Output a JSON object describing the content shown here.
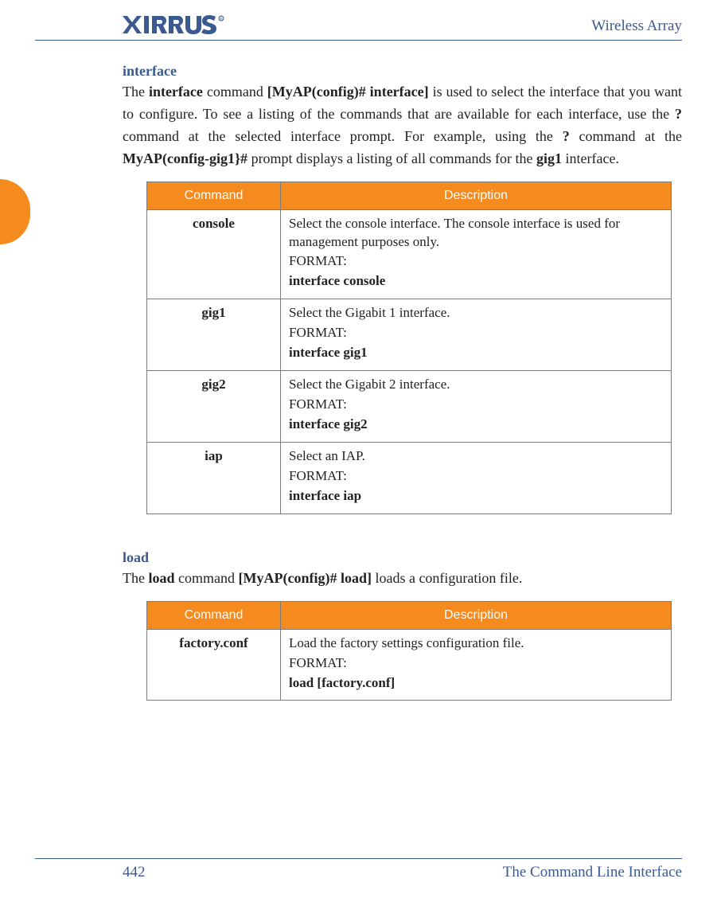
{
  "header": {
    "logo_text": "XIRRUS",
    "doc_title": "Wireless Array"
  },
  "sections": [
    {
      "title": "interface",
      "intro_html": "The <b>interface</b> command <b>[MyAP(config)# interface]</b> is used to select the interface that you want to configure. To see a listing of the commands that are available for each interface, use the <b>?</b> command at the selected interface prompt. For example, using the <b>?</b> command at the <b>MyAP(config-gig1}#</b> prompt displays a listing of all commands for the <b>gig1</b> interface.",
      "table": {
        "head_cmd": "Command",
        "head_desc": "Description",
        "rows": [
          {
            "cmd": "console",
            "desc": "Select the console interface. The console interface is used for management purposes only.",
            "fmt_label": "FORMAT:",
            "fmt": "interface console"
          },
          {
            "cmd": "gig1",
            "desc": "Select the Gigabit 1 interface.",
            "fmt_label": "FORMAT:",
            "fmt": "interface gig1"
          },
          {
            "cmd": "gig2",
            "desc": "Select the Gigabit 2 interface.",
            "fmt_label": "FORMAT:",
            "fmt": "interface gig2"
          },
          {
            "cmd": "iap",
            "desc": "Select an IAP.",
            "fmt_label": "FORMAT:",
            "fmt": "interface iap"
          }
        ]
      }
    },
    {
      "title": "load",
      "intro_html": "The <b>load</b> command <b>[MyAP(config)# load]</b> loads a configuration file.",
      "table": {
        "head_cmd": "Command",
        "head_desc": "Description",
        "rows": [
          {
            "cmd": "factory.conf",
            "desc": "Load the factory settings configuration file.",
            "fmt_label": "FORMAT:",
            "fmt": "load [factory.conf]"
          }
        ]
      }
    }
  ],
  "footer": {
    "page": "442",
    "chapter": "The Command Line Interface"
  }
}
